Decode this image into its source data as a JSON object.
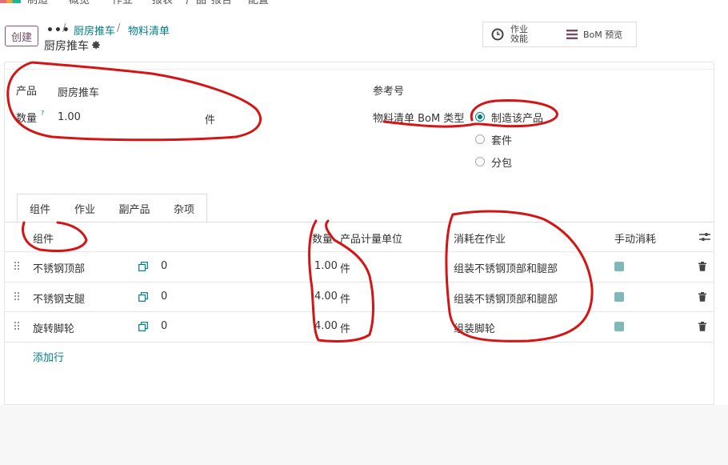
{
  "topnav": {
    "items": [
      "制造",
      "概览",
      "作业",
      "报表",
      "产品",
      "报告",
      "配置"
    ]
  },
  "control": {
    "create_label": "创建",
    "breadcrumb_dots": "•••",
    "breadcrumb_1": "厨房推车",
    "breadcrumb_2": "物料清单",
    "record_title": "厨房推车"
  },
  "stat_buttons": {
    "efficiency_line1": "作业",
    "efficiency_line2": "效能",
    "bom_preview": "BoM 预览"
  },
  "form": {
    "product_label": "产品",
    "product_value": "厨房推车",
    "qty_label": "数量",
    "qty_help": "?",
    "qty_value": "1.00",
    "uom_value": "件",
    "ref_label": "参考号",
    "type_label": "物料清单 BoM 类型",
    "type_options": [
      "制造该产品",
      "套件",
      "分包"
    ],
    "type_selected": "制造该产品"
  },
  "tabs": [
    "组件",
    "作业",
    "副产品",
    "杂项"
  ],
  "table": {
    "headers": {
      "component": "组件",
      "qty": "数量",
      "uom": "产品计量单位",
      "operation": "消耗在作业",
      "manual": "手动消耗"
    },
    "rows": [
      {
        "component": "不锈钢顶部",
        "stock": "0",
        "qty": "1.00",
        "uom": "件",
        "operation": "组装不锈钢顶部和腿部",
        "manual": true
      },
      {
        "component": "不锈钢支腿",
        "stock": "0",
        "qty": "4.00",
        "uom": "件",
        "operation": "组装不锈钢顶部和腿部",
        "manual": true
      },
      {
        "component": "旋转脚轮",
        "stock": "0",
        "qty": "4.00",
        "uom": "件",
        "operation": "组装脚轮",
        "manual": true
      }
    ],
    "add_line": "添加行"
  },
  "colors": {
    "accent": "#017e84",
    "brand": "#714b67",
    "annotation": "#d31515"
  }
}
